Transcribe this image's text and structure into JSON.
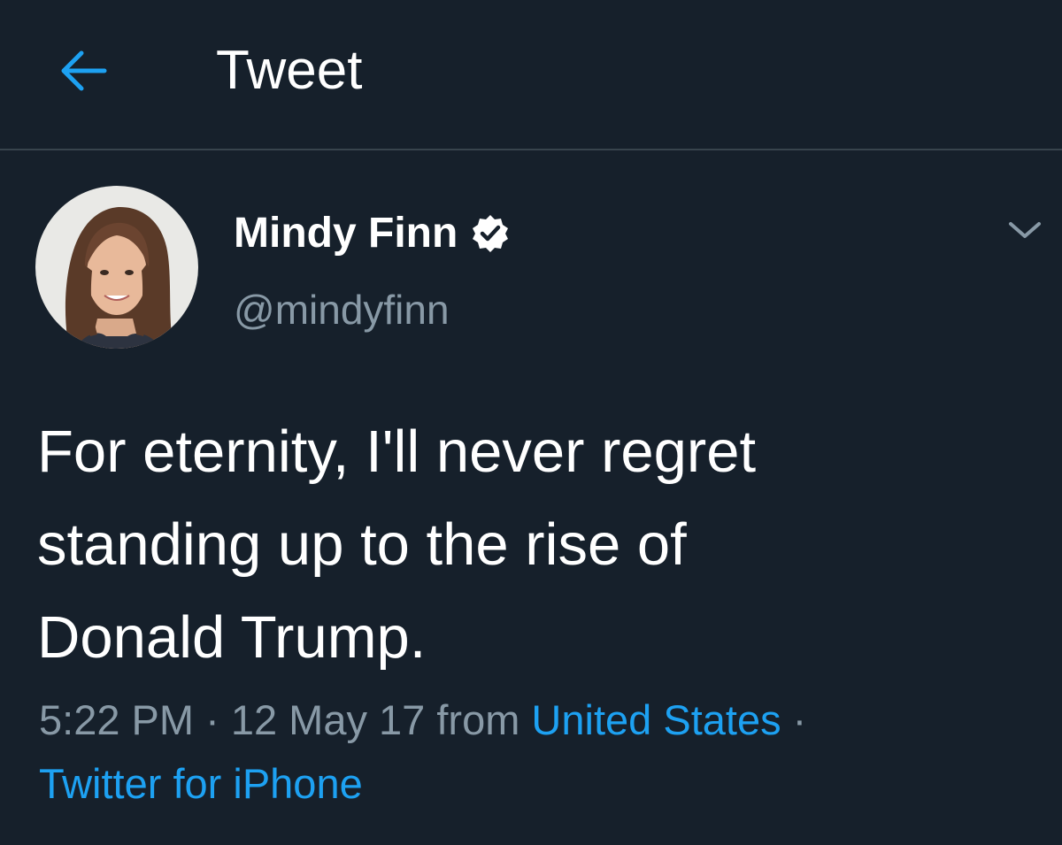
{
  "header": {
    "title": "Tweet",
    "back_icon": "arrow-left-icon"
  },
  "tweet": {
    "author": {
      "name": "Mindy Finn",
      "handle": "@mindyfinn",
      "verified_icon": "verified-badge-icon"
    },
    "menu_icon": "chevron-down-icon",
    "lines": [
      "For eternity, I'll never regret",
      "standing up to the rise of",
      "Donald Trump."
    ],
    "meta": {
      "time": "5:22 PM",
      "separator": " · ",
      "date": "12 May 17",
      "from_label": " from ",
      "location": "United States",
      "separator2": " ·",
      "client": "Twitter for iPhone"
    }
  },
  "colors": {
    "background": "#16202b",
    "divider": "#38444d",
    "text_primary": "#ffffff",
    "text_secondary": "#8899a6",
    "accent": "#1da1f2"
  }
}
